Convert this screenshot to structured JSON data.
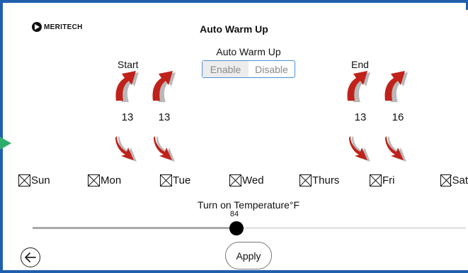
{
  "header": {
    "logo_text": "MERITECH",
    "title": "Auto Warm Up"
  },
  "mode": {
    "label": "Auto Warm Up",
    "options": [
      "Enable",
      "Disable"
    ],
    "selected": "Enable"
  },
  "schedule": {
    "start": {
      "label": "Start",
      "values": [
        "13",
        "13"
      ]
    },
    "end": {
      "label": "End",
      "values": [
        "13",
        "16"
      ]
    }
  },
  "days": [
    {
      "label": "Sun",
      "checked": true
    },
    {
      "label": "Mon",
      "checked": true
    },
    {
      "label": "Tue",
      "checked": true
    },
    {
      "label": "Wed",
      "checked": true
    },
    {
      "label": "Thurs",
      "checked": true
    },
    {
      "label": "Fri",
      "checked": true
    },
    {
      "label": "Sat",
      "checked": true
    }
  ],
  "temperature": {
    "label": "Turn on Temperature°F",
    "value": "84",
    "fill_fraction": 0.47
  },
  "footer": {
    "apply_label": "Apply",
    "back_icon": "arrow-left-icon"
  },
  "colors": {
    "frame_border": "#1f5fae",
    "segment_border": "#4a8fd8",
    "arrow_red": "#c0221b",
    "arrow_gray": "#b9b9b9",
    "side_arrow": "#2eae6c"
  }
}
